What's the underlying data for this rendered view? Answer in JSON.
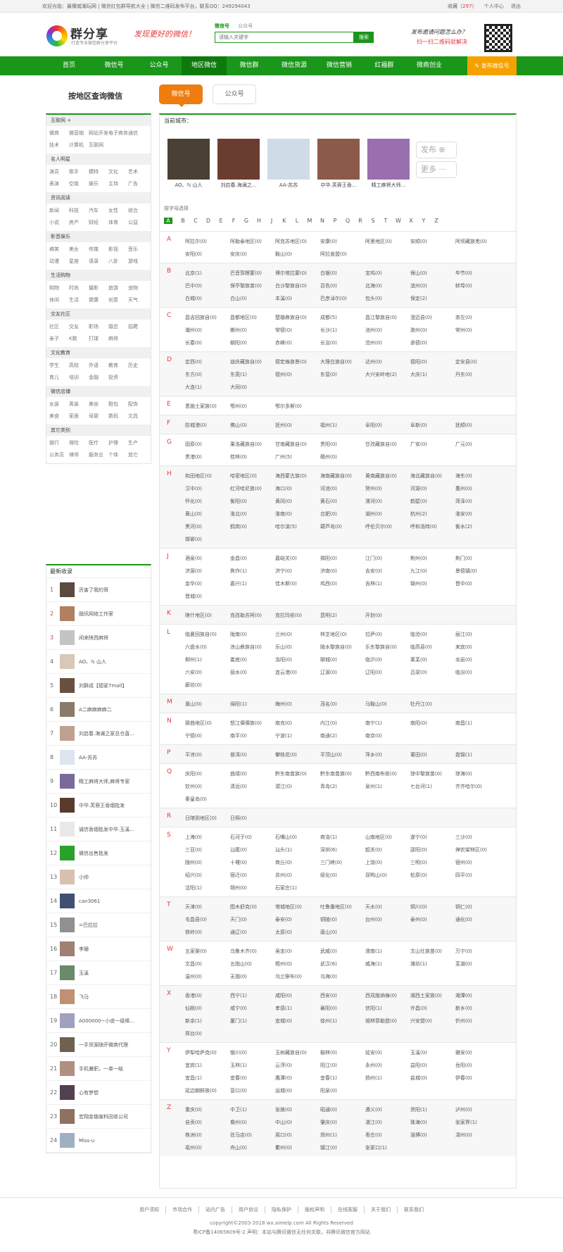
{
  "topbar": {
    "left": "欢迎光临：最權威潮玩网 | 微信红包群导航大全 | 微信二维码发布平台，联系QQ：249294043",
    "favorite": "收藏",
    "fav_count": "297",
    "user_center": "个人中心",
    "logout": "退出"
  },
  "header": {
    "brand": "群分享",
    "brand_sub": "打造专业微信群分享平台",
    "slogan": "发现更好的微信！",
    "search_tab1": "微信号",
    "search_tab2": "公众号",
    "search_placeholder": "请输入关键字",
    "search_btn": "搜索",
    "ad_line1": "发布邀请问题怎么办？",
    "ad_line2": "扫一扫二维码就解决"
  },
  "nav": [
    "首页",
    "微信号",
    "公众号",
    "地区微信",
    "微信群",
    "微信货源",
    "微信营销",
    "红福群",
    "微商创业"
  ],
  "nav_publish": "发布微信号",
  "page_title": "按地区查询微信",
  "tabs": [
    "微信号",
    "公众号"
  ],
  "categories": [
    {
      "name": "互联网 +",
      "items": [
        "微商",
        "微营销",
        "网站开发",
        "电子商务",
        "通信",
        "技术",
        "计算机",
        "互联网"
      ]
    },
    {
      "name": "名人明星",
      "items": [
        "演员",
        "歌手",
        "模特",
        "文化",
        "艺术",
        "表演",
        "空姐",
        "娱乐",
        "主持",
        "广告"
      ]
    },
    {
      "name": "资讯阅读",
      "items": [
        "新闻",
        "科技",
        "汽车",
        "女性",
        "综合",
        "小说",
        "房产",
        "财经",
        "体育",
        "公益"
      ]
    },
    {
      "name": "影音娱乐",
      "items": [
        "搞笑",
        "美女",
        "传媒",
        "影视",
        "音乐",
        "动漫",
        "星座",
        "语录",
        "八卦",
        "游戏"
      ]
    },
    {
      "name": "生活购物",
      "items": [
        "购物",
        "时尚",
        "摄影",
        "旅游",
        "宠物",
        "休闲",
        "生活",
        "健康",
        "创意",
        "天气"
      ]
    },
    {
      "name": "交友社区",
      "items": [
        "社区",
        "交友",
        "职场",
        "婚恋",
        "招聘",
        "亲子",
        "K歌",
        "打球",
        "麻将"
      ]
    },
    {
      "name": "文化教育",
      "items": [
        "学生",
        "高校",
        "外语",
        "教育",
        "历史",
        "育儿",
        "培训",
        "金融",
        "投资"
      ]
    },
    {
      "name": "微信店铺",
      "items": [
        "女装",
        "男装",
        "美妆",
        "鞋包",
        "配饰",
        "美食",
        "家居",
        "母婴",
        "数码",
        "文具"
      ]
    },
    {
      "name": "其它类别",
      "items": [
        "银行",
        "保险",
        "医疗",
        "护理",
        "生产",
        "公务员",
        "律师",
        "服务业",
        "个体",
        "其它"
      ]
    }
  ],
  "latest": {
    "title": "最新收录",
    "items": [
      "厉害了我的哥",
      "融讯网络工作室",
      "闲来陕西麻将",
      "AO、ℕ 山人",
      "刘群成【德家7mall】",
      "A二麻麻麻麻二",
      "刘启春.海澜之家总仓直...",
      "AA-苏苏",
      "精工麻将大师,麻将专家",
      "中华.芙蓉王香烟批发",
      "诚信香烟批发中华.玉溪...",
      "微信出售批发",
      "小帅",
      "can3061",
      "=巴拉拉",
      "李珊",
      "玉溪",
      "飞马",
      "A000000~小皮一级棒...",
      "一手货源随开微商代理",
      "手机兼职，一单一结",
      "心有梦想",
      "宏翔金银废料回收公司",
      "Miss-u"
    ]
  },
  "main": {
    "current_city": "当前城市：",
    "index_label": "按字母选择",
    "post": "发布",
    "more": "更多",
    "avatars": [
      {
        "name": "AO、ℕ 山人"
      },
      {
        "name": "刘启春.海澜之..."
      },
      {
        "name": "AA-苏苏"
      },
      {
        "name": "中华.芙蓉王香..."
      },
      {
        "name": "精工麻将大师..."
      }
    ],
    "letters": [
      "A",
      "B",
      "C",
      "D",
      "E",
      "F",
      "G",
      "H",
      "J",
      "K",
      "L",
      "M",
      "N",
      "P",
      "Q",
      "R",
      "S",
      "T",
      "W",
      "X",
      "Y",
      "Z"
    ],
    "groups": [
      {
        "letter": "A",
        "cities": [
          "阿拉尔(0)",
          "阿勒泰地区(0)",
          "阿克苏地区(0)",
          "安康(0)",
          "阿里地区(0)",
          "安顺(0)",
          "阿坝藏族羌(0)",
          "安阳(0)",
          "安庆(0)",
          "鞍山(0)",
          "阿拉善盟(0)"
        ]
      },
      {
        "letter": "B",
        "cities": [
          "北京(1)",
          "巴音郭楞蒙(0)",
          "博尔塔拉蒙(0)",
          "白银(0)",
          "宝鸡(0)",
          "保山(0)",
          "毕节(0)",
          "巴中(0)",
          "保亭黎族苗(0)",
          "白沙黎族自(0)",
          "百色(0)",
          "北海(0)",
          "滨州(0)",
          "蚌埠(0)",
          "白城(0)",
          "白山(0)",
          "本溪(0)",
          "巴彦淖尔(0)",
          "包头(0)",
          "保定(2)"
        ]
      },
      {
        "letter": "C",
        "cities": [
          "昌吉回族自(0)",
          "昌都地区(0)",
          "楚雄彝族自(0)",
          "成都(5)",
          "昌江黎族自(0)",
          "澄迈县(0)",
          "崇左(0)",
          "潮州(0)",
          "郴州(0)",
          "常德(0)",
          "长沙(1)",
          "池州(0)",
          "滁州(0)",
          "常州(0)",
          "长春(0)",
          "朝阳(0)",
          "赤峰(0)",
          "长治(0)",
          "沧州(0)",
          "承德(0)"
        ]
      },
      {
        "letter": "D",
        "cities": [
          "定西(0)",
          "迪庆藏族自(0)",
          "德宏傣族景(0)",
          "大理白族自(0)",
          "达州(0)",
          "德阳(0)",
          "定安县(0)",
          "东方(0)",
          "东莞(1)",
          "德州(0)",
          "东营(0)",
          "大兴安岭地(2)",
          "大庆(1)",
          "丹东(0)",
          "大连(1)",
          "大同(0)"
        ]
      },
      {
        "letter": "E",
        "cities": [
          "恩施土家族(0)",
          "鄂州(0)",
          "鄂尔多斯(0)"
        ]
      },
      {
        "letter": "F",
        "cities": [
          "防城港(0)",
          "佛山(0)",
          "抚州(0)",
          "福州(1)",
          "阜阳(0)",
          "阜新(0)",
          "抚顺(0)"
        ]
      },
      {
        "letter": "G",
        "cities": [
          "固原(0)",
          "果洛藏族自(0)",
          "甘南藏族自(0)",
          "贵阳(0)",
          "甘孜藏族自(0)",
          "广安(0)",
          "广元(0)",
          "贵港(0)",
          "桂林(0)",
          "广州(5)",
          "赣州(0)"
        ]
      },
      {
        "letter": "H",
        "cities": [
          "和田地区(0)",
          "哈密地区(0)",
          "海西蒙古族(0)",
          "海南藏族自(0)",
          "黄南藏族自(0)",
          "海北藏族自(0)",
          "海东(0)",
          "汉中(0)",
          "红河哈尼族(0)",
          "海口(0)",
          "河池(0)",
          "贺州(0)",
          "河源(0)",
          "惠州(0)",
          "怀化(0)",
          "衡阳(0)",
          "黄冈(0)",
          "黄石(0)",
          "漯河(0)",
          "鹤壁(0)",
          "菏泽(0)",
          "黄山(0)",
          "淮北(0)",
          "淮南(0)",
          "合肥(0)",
          "湖州(0)",
          "杭州(2)",
          "淮安(0)",
          "黑河(0)",
          "鹤岗(0)",
          "哈尔滨(5)",
          "葫芦岛(0)",
          "呼伦贝尔(0)",
          "呼和浩特(0)",
          "衡水(2)",
          "邯郸(0)"
        ]
      },
      {
        "letter": "J",
        "cities": [
          "酒泉(0)",
          "金昌(0)",
          "嘉峪关(0)",
          "揭阳(0)",
          "江门(0)",
          "荆州(0)",
          "荆门(0)",
          "济源(0)",
          "焦作(1)",
          "济宁(0)",
          "济南(0)",
          "吉安(0)",
          "九江(0)",
          "景德镇(0)",
          "金华(0)",
          "嘉兴(1)",
          "佳木斯(0)",
          "鸡西(0)",
          "吉林(1)",
          "锦州(0)",
          "晋中(0)",
          "晋城(0)"
        ]
      },
      {
        "letter": "K",
        "cities": [
          "喀什地区(0)",
          "克孜勒苏柯(0)",
          "克拉玛依(0)",
          "昆明(2)",
          "开封(0)"
        ]
      },
      {
        "letter": "L",
        "cities": [
          "临夏回族自(0)",
          "陇南(0)",
          "兰州(0)",
          "林芝地区(0)",
          "拉萨(0)",
          "临沧(0)",
          "丽江(0)",
          "六盘水(0)",
          "凉山彝族自(0)",
          "乐山(0)",
          "陵水黎族自(0)",
          "乐东黎族自(0)",
          "临高县(0)",
          "来宾(0)",
          "柳州(1)",
          "娄底(0)",
          "洛阳(0)",
          "聊城(0)",
          "临沂(0)",
          "莱芜(0)",
          "龙岩(0)",
          "六安(0)",
          "丽水(0)",
          "连云港(0)",
          "辽源(0)",
          "辽阳(0)",
          "吕梁(0)",
          "临汾(0)",
          "廊坊(0)"
        ]
      },
      {
        "letter": "M",
        "cities": [
          "眉山(0)",
          "绵阳(1)",
          "梅州(0)",
          "茂名(0)",
          "马鞍山(0)",
          "牡丹江(0)"
        ]
      },
      {
        "letter": "N",
        "cities": [
          "那曲地区(0)",
          "怒江傈僳族(0)",
          "南充(0)",
          "内江(0)",
          "南宁(1)",
          "南阳(0)",
          "南昌(1)",
          "宁德(0)",
          "南平(0)",
          "宁波(1)",
          "南通(2)",
          "南京(0)"
        ]
      },
      {
        "letter": "P",
        "cities": [
          "平凉(0)",
          "普洱(0)",
          "攀枝花(0)",
          "平顶山(0)",
          "萍乡(0)",
          "莆田(0)",
          "盘锦(1)"
        ]
      },
      {
        "letter": "Q",
        "cities": [
          "庆阳(0)",
          "曲靖(0)",
          "黔东南苗族(0)",
          "黔东南苗族(0)",
          "黔西南布依(0)",
          "琼中黎族苗(0)",
          "琼海(0)",
          "钦州(0)",
          "清远(0)",
          "潜江(0)",
          "青岛(2)",
          "泉州(1)",
          "七台河(1)",
          "齐齐哈尔(0)",
          "秦皇岛(0)"
        ]
      },
      {
        "letter": "R",
        "cities": [
          "日喀则地区(0)",
          "日照(0)"
        ]
      },
      {
        "letter": "S",
        "cities": [
          "上海(0)",
          "石河子(0)",
          "石嘴山(0)",
          "商洛(1)",
          "山南地区(0)",
          "遂宁(0)",
          "三沙(0)",
          "三亚(0)",
          "汕尾(0)",
          "汕头(1)",
          "深圳(6)",
          "韶关(0)",
          "邵阳(0)",
          "神农架林区(0)",
          "随州(0)",
          "十堰(0)",
          "商丘(0)",
          "三门峡(0)",
          "上饶(0)",
          "三明(0)",
          "宿州(0)",
          "绍兴(0)",
          "宿迁(0)",
          "苏州(0)",
          "绥化(0)",
          "双鸭山(0)",
          "松原(0)",
          "四平(0)",
          "沈阳(1)",
          "朔州(0)",
          "石家庄(1)"
        ]
      },
      {
        "letter": "T",
        "cities": [
          "天津(0)",
          "图木舒克(0)",
          "塔城地区(0)",
          "吐鲁番地区(0)",
          "天水(0)",
          "铜川(0)",
          "铜仁(0)",
          "屯昌县(0)",
          "天门(0)",
          "泰安(0)",
          "铜陵(0)",
          "台州(0)",
          "泰州(0)",
          "通化(0)",
          "铁岭(0)",
          "通辽(0)",
          "太原(0)",
          "唐山(0)"
        ]
      },
      {
        "letter": "W",
        "cities": [
          "五家渠(0)",
          "乌鲁木齐(0)",
          "吴忠(0)",
          "武威(0)",
          "渭南(1)",
          "文山壮族苗(0)",
          "万宁(0)",
          "文昌(0)",
          "五指山(0)",
          "梧州(0)",
          "武汉(6)",
          "威海(1)",
          "潍坊(1)",
          "芜湖(0)",
          "温州(0)",
          "无锡(0)",
          "乌兰察布(0)",
          "乌海(0)"
        ]
      },
      {
        "letter": "X",
        "cities": [
          "香港(0)",
          "西宁(1)",
          "咸阳(0)",
          "西安(0)",
          "西双版纳傣(0)",
          "湘西土家族(0)",
          "湘潭(0)",
          "仙桃(0)",
          "咸宁(0)",
          "孝感(1)",
          "襄阳(0)",
          "信阳(1)",
          "许昌(0)",
          "新乡(0)",
          "新余(1)",
          "厦门(1)",
          "宣城(0)",
          "徐州(1)",
          "锡林郭勒盟(0)",
          "兴安盟(0)",
          "忻州(0)",
          "邢台(0)"
        ]
      },
      {
        "letter": "Y",
        "cities": [
          "伊犁哈萨克(0)",
          "银川(0)",
          "玉树藏族自(0)",
          "榆林(0)",
          "延安(0)",
          "玉溪(0)",
          "雅安(0)",
          "宜宾(1)",
          "玉林(1)",
          "云浮(0)",
          "阳江(0)",
          "永州(0)",
          "益阳(0)",
          "岳阳(0)",
          "宜昌(1)",
          "宜春(0)",
          "鹰潭(0)",
          "宜春(1)",
          "扬州(1)",
          "盐城(0)",
          "伊春(0)",
          "延边朝鲜族(0)",
          "营口(0)",
          "运城(0)",
          "阳泉(0)"
        ]
      },
      {
        "letter": "Z",
        "cities": [
          "重庆(0)",
          "中卫(1)",
          "张掖(0)",
          "昭通(0)",
          "遵义(0)",
          "资阳(1)",
          "泸州(0)",
          "自贡(0)",
          "儋州(0)",
          "中山(0)",
          "肇庆(0)",
          "湛江(0)",
          "珠海(0)",
          "张家界(1)",
          "株洲(0)",
          "驻马店(0)",
          "周口(0)",
          "郑州(1)",
          "枣庄(0)",
          "淄博(0)",
          "漳州(0)",
          "亳州(0)",
          "舟山(0)",
          "衢州(0)",
          "镇江(0)",
          "张家口(1)"
        ]
      }
    ]
  },
  "footer": {
    "links": [
      "用户须知",
      "市场合作",
      "站内广告",
      "用户协议",
      "隐私保护",
      "版权声明",
      "在线客服",
      "关于我们",
      "联系我们"
    ],
    "copyright": "copyright©2003-2018 wx.aimeip.com All Rights Reserved",
    "icp": "粤ICP备14065609号-2    声明：本站与腾讯微信无任何关联，非腾讯微信官方网站"
  }
}
